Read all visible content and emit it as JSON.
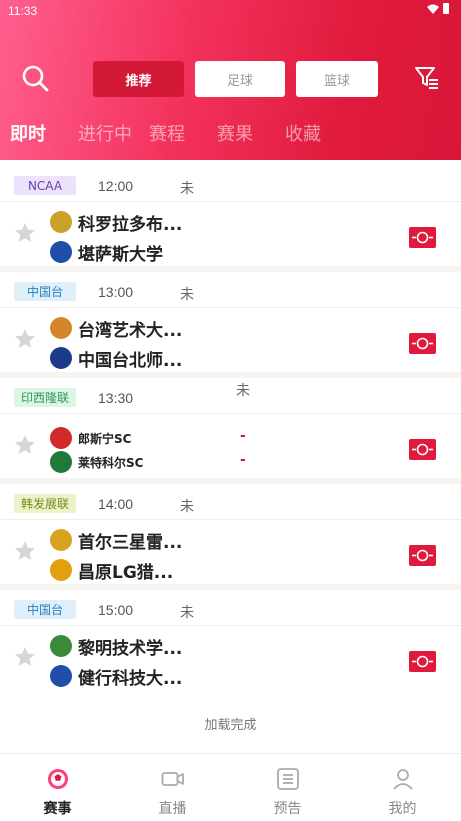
{
  "status_bar": {
    "time": "11:33"
  },
  "header": {
    "pills": [
      "推荐",
      "足球",
      "篮球"
    ],
    "subtabs": [
      "即时",
      "进行中",
      "赛程",
      "赛果",
      "收藏"
    ]
  },
  "matches": [
    {
      "league": "NCAA",
      "league_bg": "#ece2fb",
      "league_color": "#6a3fb2",
      "time": "12:00",
      "status": "未",
      "home": "科罗拉多布...",
      "away": "堪萨斯大学",
      "home_logo_color": "#c9a227",
      "away_logo_color": "#1e4ea8",
      "home_score": "",
      "away_score": ""
    },
    {
      "league": "中国台",
      "league_bg": "#dff0fb",
      "league_color": "#2a7fc0",
      "time": "13:00",
      "status": "未",
      "home": "台湾艺术大...",
      "away": "中国台北师...",
      "home_logo_color": "#d4862a",
      "away_logo_color": "#1b3b8a",
      "home_score": "",
      "away_score": ""
    },
    {
      "league": "印西隆联",
      "league_bg": "#dcf5e5",
      "league_color": "#2e9a5a",
      "time": "13:30",
      "status": "未",
      "home": "郎斯宁SC",
      "away": "莱特科尔SC",
      "home_logo_color": "#d02a2a",
      "away_logo_color": "#1f7a3a",
      "home_score": "-",
      "away_score": "-"
    },
    {
      "league": "韩发展联",
      "league_bg": "#ecf3c8",
      "league_color": "#7a8a1a",
      "time": "14:00",
      "status": "未",
      "home": "首尔三星雷...",
      "away": "昌原LG猎...",
      "home_logo_color": "#d9a21e",
      "away_logo_color": "#e0a010",
      "home_score": "",
      "away_score": ""
    },
    {
      "league": "中国台",
      "league_bg": "#dff0fb",
      "league_color": "#2a7fc0",
      "time": "15:00",
      "status": "未",
      "home": "黎明技术学...",
      "away": "健行科技大...",
      "home_logo_color": "#3a8a3a",
      "away_logo_color": "#1f4fa8",
      "home_score": "",
      "away_score": ""
    }
  ],
  "footer_text": "加载完成",
  "bottom_nav": [
    "赛事",
    "直播",
    "预告",
    "我的"
  ],
  "colors": {
    "accent": "#e01a3c",
    "accent_dark": "#d41838"
  }
}
